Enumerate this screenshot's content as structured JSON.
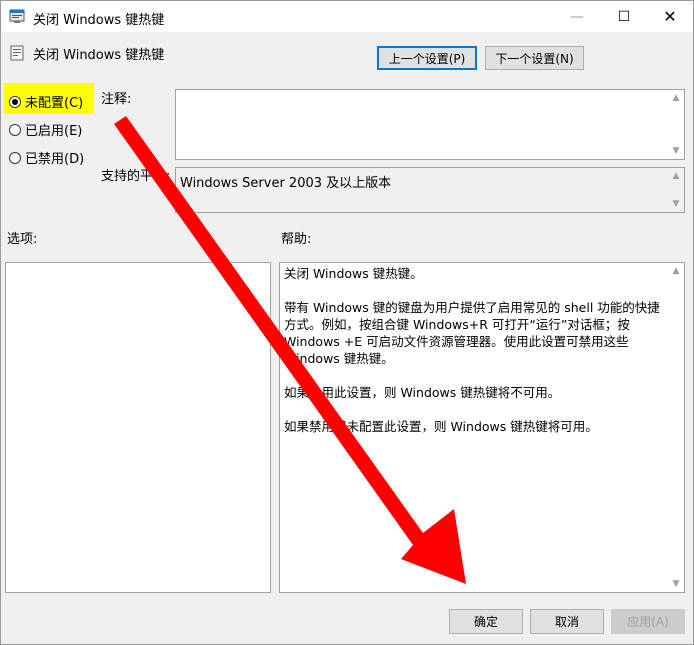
{
  "window": {
    "title": "关闭 Windows 键热键",
    "minimize_glyph": "—",
    "maximize_glyph": "☐",
    "close_glyph": "✕"
  },
  "header": {
    "policy_name": "关闭 Windows 键热键",
    "prev_label": "上一个设置(P)",
    "next_label": "下一个设置(N)"
  },
  "state": {
    "options": [
      {
        "label": "未配置(C)",
        "checked": true
      },
      {
        "label": "已启用(E)",
        "checked": false
      },
      {
        "label": "已禁用(D)",
        "checked": false
      }
    ]
  },
  "fields": {
    "comment_label": "注释:",
    "comment_value": "",
    "platform_label": "支持的平台:",
    "platform_value": "Windows Server 2003 及以上版本"
  },
  "sections": {
    "options_label": "选项:",
    "help_label": "帮助:"
  },
  "help": {
    "paragraphs": [
      "关闭 Windows 键热键。",
      "带有 Windows 键的键盘为用户提供了启用常见的 shell 功能的快捷方式。例如，按组合键 Windows+R 可打开“运行”对话框；按 Windows +E 可启动文件资源管理器。使用此设置可禁用这些 Windows 键热键。",
      "如果启用此设置，则 Windows 键热键将不可用。",
      "如果禁用或未配置此设置，则 Windows 键热键将可用。"
    ]
  },
  "footer": {
    "ok_label": "确定",
    "cancel_label": "取消",
    "apply_label": "应用(A)"
  },
  "colors": {
    "highlight": "#ffff00",
    "annotation_arrow": "#ff0000",
    "focus_border": "#0078d7"
  },
  "icons": {
    "app": "policy-editor-icon",
    "policy": "policy-setting-icon",
    "scroll_up": "scroll-up-icon",
    "scroll_down": "scroll-down-icon"
  }
}
